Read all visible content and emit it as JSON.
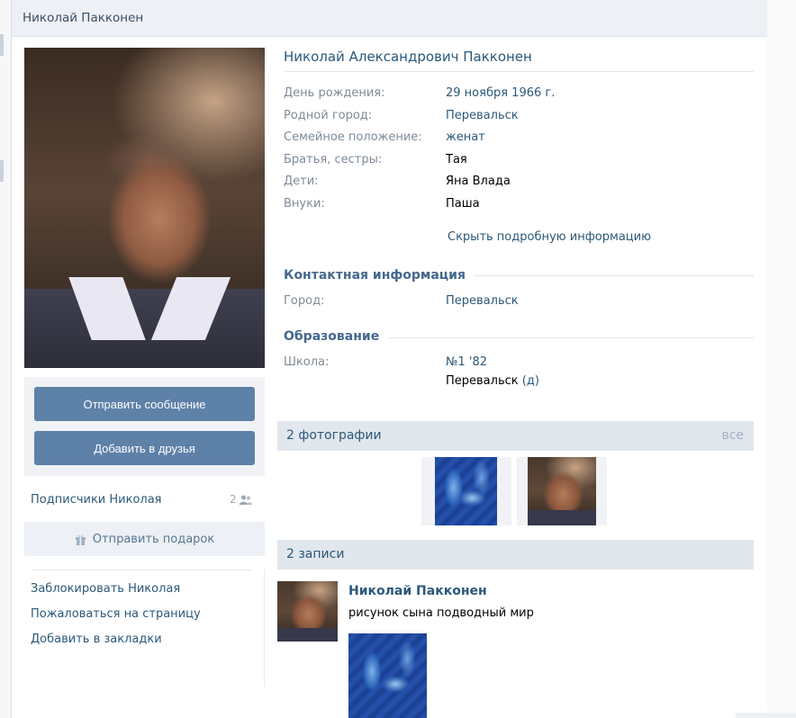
{
  "header": {
    "title": "Николай Пакконен"
  },
  "profile": {
    "full_name": "Николай Александрович Пакконен",
    "info": [
      {
        "label": "День рождения:",
        "value": "29 ноября 1966 г.",
        "link": true
      },
      {
        "label": "Родной город:",
        "value": "Перевальск",
        "link": true
      },
      {
        "label": "Семейное положение:",
        "value": "женат",
        "link": true
      },
      {
        "label": "Братья, сестры:",
        "value": "Тая",
        "link": false
      },
      {
        "label": "Дети:",
        "value": "Яна Влада",
        "link": false
      },
      {
        "label": "Внуки:",
        "value": "Паша",
        "link": false
      }
    ],
    "hide_info_link": "Скрыть подробную информацию"
  },
  "contact": {
    "heading": "Контактная информация",
    "city_label": "Город:",
    "city_value": "Перевальск"
  },
  "education": {
    "heading": "Образование",
    "school_label": "Школа:",
    "school_value": "№1 '82",
    "school_city": "Перевальск",
    "school_city_suffix": "(д)"
  },
  "actions": {
    "send_message": "Отправить сообщение",
    "add_friend": "Добавить в друзья",
    "send_gift": "Отправить подарок"
  },
  "followers": {
    "label": "Подписчики Николая",
    "count": "2"
  },
  "side_links": {
    "block": "Заблокировать Николая",
    "report": "Пожаловаться на страницу",
    "bookmark": "Добавить в закладки"
  },
  "photos": {
    "title": "2 фотографии",
    "all_label": "все"
  },
  "wall": {
    "title": "2 записи",
    "post": {
      "author": "Николай Пакконен",
      "text": "рисунок сына подводный мир"
    }
  },
  "colors": {
    "link": "#2b587a",
    "button": "#5e81a8",
    "header_bg": "#edf0f4",
    "label": "#7e8b98"
  }
}
